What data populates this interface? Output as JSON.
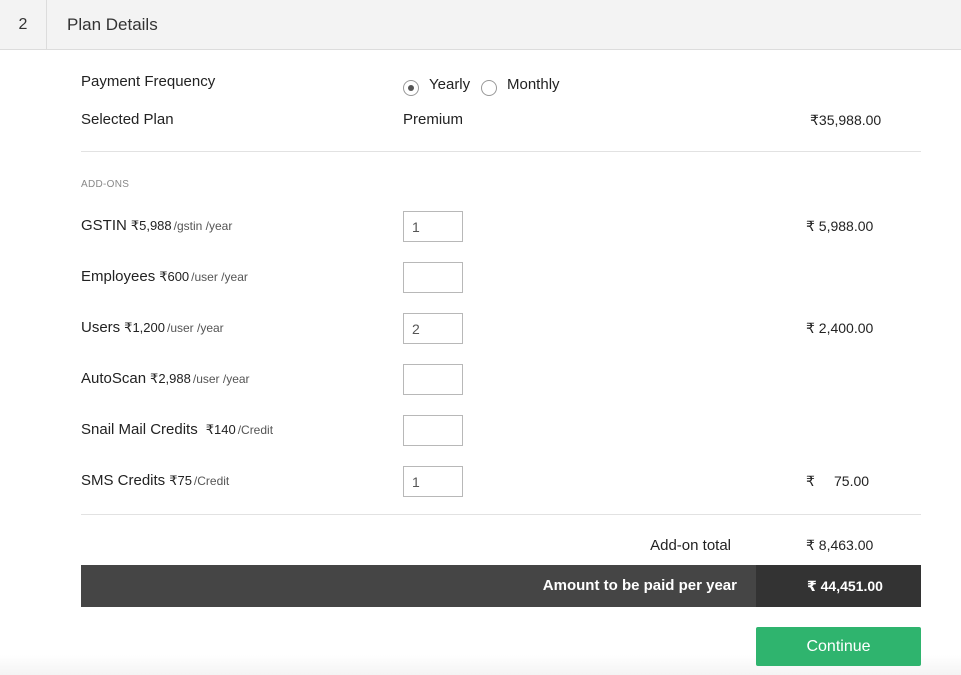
{
  "step": {
    "number": "2",
    "title": "Plan Details"
  },
  "payment_frequency": {
    "label": "Payment Frequency",
    "options": [
      {
        "label": "Yearly",
        "selected": true
      },
      {
        "label": "Monthly",
        "selected": false
      }
    ]
  },
  "selected_plan": {
    "label": "Selected Plan",
    "plan": "Premium",
    "amount": "₹35,988.00"
  },
  "addons": {
    "heading": "ADD-ONS",
    "items": [
      {
        "name": "GSTIN",
        "price": "₹5,988",
        "unit": "/gstin /year",
        "qty": "1",
        "amount": "₹ 5,988.00"
      },
      {
        "name": "Employees",
        "price": "₹600",
        "unit": "/user /year",
        "qty": "",
        "amount": ""
      },
      {
        "name": "Users",
        "price": "₹1,200",
        "unit": "/user /year",
        "qty": "2",
        "amount": "₹ 2,400.00"
      },
      {
        "name": "AutoScan",
        "price": "₹2,988",
        "unit": "/user /year",
        "qty": "",
        "amount": ""
      },
      {
        "name": "Snail Mail Credits",
        "price": "₹140",
        "unit": "/Credit",
        "qty": "",
        "amount": ""
      },
      {
        "name": "SMS Credits",
        "price": "₹75",
        "unit": "/Credit",
        "qty": "1",
        "amount_symbol": "₹",
        "amount_value": "75.00"
      }
    ]
  },
  "addon_total": {
    "label": "Add-on total",
    "amount": "₹ 8,463.00"
  },
  "pay_per_year": {
    "label": "Amount to be paid per year",
    "amount": "₹ 44,451.00"
  },
  "continue_label": "Continue",
  "colors": {
    "accent": "#2fb46e",
    "bar_dark": "#454545",
    "bar_darker": "#333333"
  }
}
